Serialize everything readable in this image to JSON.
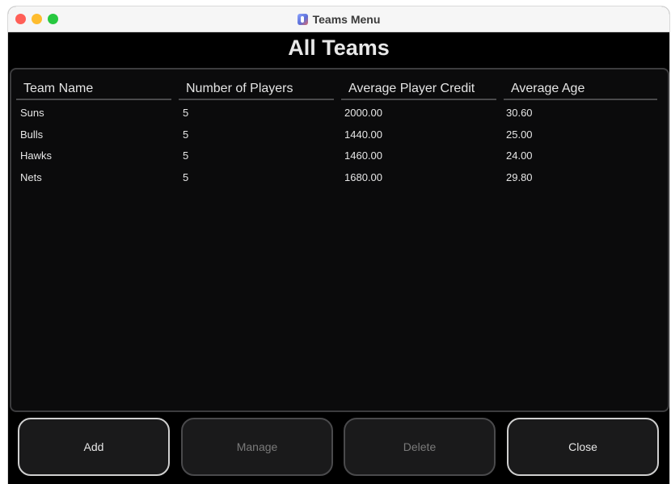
{
  "window": {
    "title": "Teams Menu"
  },
  "page": {
    "title": "All Teams"
  },
  "table": {
    "columns": [
      "Team Name",
      "Number of Players",
      "Average Player Credit",
      "Average Age"
    ],
    "rows": [
      [
        "Suns",
        "5",
        "2000.00",
        "30.60"
      ],
      [
        "Bulls",
        "5",
        "1440.00",
        "25.00"
      ],
      [
        "Hawks",
        "5",
        "1460.00",
        "24.00"
      ],
      [
        "Nets",
        "5",
        "1680.00",
        "29.80"
      ]
    ]
  },
  "buttons": {
    "add": "Add",
    "manage": "Manage",
    "delete": "Delete",
    "close": "Close"
  },
  "colors": {
    "window_bg": "#000000",
    "panel_bg": "#0b0b0c",
    "close_light": "#ff5f57",
    "minimize_light": "#febc2e",
    "maximize_light": "#28c840"
  }
}
